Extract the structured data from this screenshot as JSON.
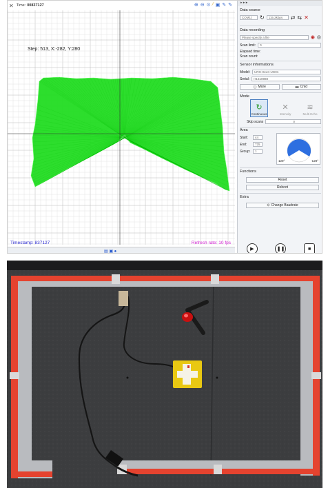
{
  "toolbar": {
    "time_label": "Time:",
    "time_value": "00837127"
  },
  "plot": {
    "step_text": "Step: 513, X:-282, Y:280",
    "timestamp_text": "Timestamp: 837127",
    "refresh_text": "Refresh rate: 10 fps",
    "scan_color": "#00ee00"
  },
  "panel": {
    "data_source_label": "Data source",
    "port_value": "COM1(",
    "baud_value": "115.2kbps",
    "data_recording_label": "Data recording",
    "file_placeholder": "Please specify a file",
    "scan_limit_label": "Scan limit:",
    "scan_limit_value": "0",
    "elapsed_label": "Elapsed time:",
    "scan_count_label": "Scan count:",
    "sensor_info_label": "Sensor informations",
    "model_label": "Model:",
    "model_value": "URG-04LX-UG01",
    "serial_label": "Serial:",
    "serial_value": "H1510988",
    "more_label": "More",
    "cmd_label": "Cmd",
    "mode_label": "Mode",
    "mode_continuous": "Continuous",
    "mode_intensity": "Intensity",
    "mode_multiecho": "Multi Echo",
    "skip_scans_label": "Skip scans",
    "skip_scans_value": "0",
    "area_label": "Area",
    "start_label": "Start:",
    "start_value": "44",
    "end_label": "End:",
    "end_value": "725",
    "group_label": "Group:",
    "group_value": "1",
    "angle_left": "120°",
    "angle_right": "-120°",
    "functions_label": "Functions",
    "reset_label": "Reset",
    "reboot_label": "Reboot",
    "extra_label": "Extra",
    "change_baud_label": "Change Baudrate"
  }
}
